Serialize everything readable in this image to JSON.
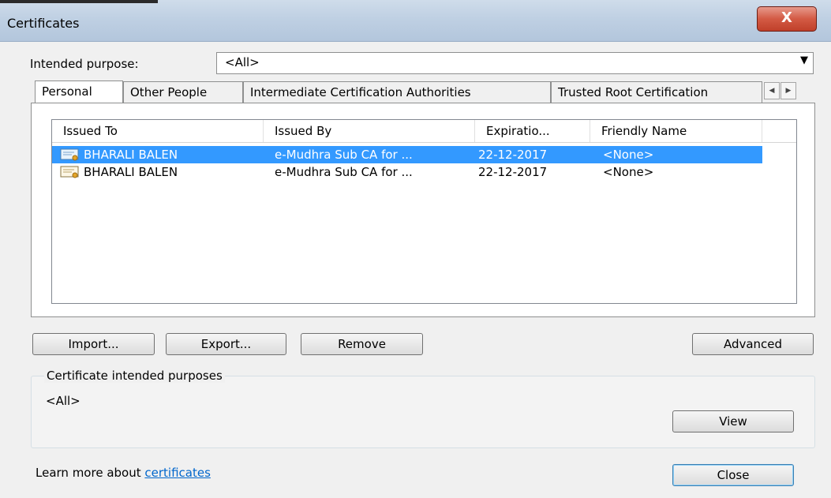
{
  "window": {
    "title": "Certificates",
    "close_glyph": "X"
  },
  "purpose": {
    "label": "Intended purpose:",
    "selected": "<All>",
    "arrow": "▼"
  },
  "tabs": [
    {
      "label": "Personal"
    },
    {
      "label": "Other People"
    },
    {
      "label": "Intermediate Certification Authorities"
    },
    {
      "label": "Trusted Root Certification"
    }
  ],
  "tab_scroll": {
    "left": "◀",
    "right": "▶"
  },
  "list": {
    "columns": [
      "Issued To",
      "Issued By",
      "Expiratio...",
      "Friendly Name"
    ],
    "rows": [
      {
        "issued_to": "BHARALI BALEN",
        "issued_by": "e-Mudhra Sub CA for ...",
        "expiration": "22-12-2017",
        "friendly_name": "<None>",
        "selected": true
      },
      {
        "issued_to": "BHARALI BALEN",
        "issued_by": "e-Mudhra Sub CA for ...",
        "expiration": "22-12-2017",
        "friendly_name": "<None>",
        "selected": false
      }
    ]
  },
  "buttons": {
    "import": "Import...",
    "export": "Export...",
    "remove": "Remove",
    "advanced": "Advanced",
    "view": "View",
    "close": "Close"
  },
  "purposes_group": {
    "title": "Certificate intended purposes",
    "value": "<All>"
  },
  "footer": {
    "learn_text": "Learn more about ",
    "learn_link": "certificates"
  },
  "colors": {
    "selection": "#3399ff",
    "link": "#0066cc",
    "close_button": "#c0402a"
  }
}
